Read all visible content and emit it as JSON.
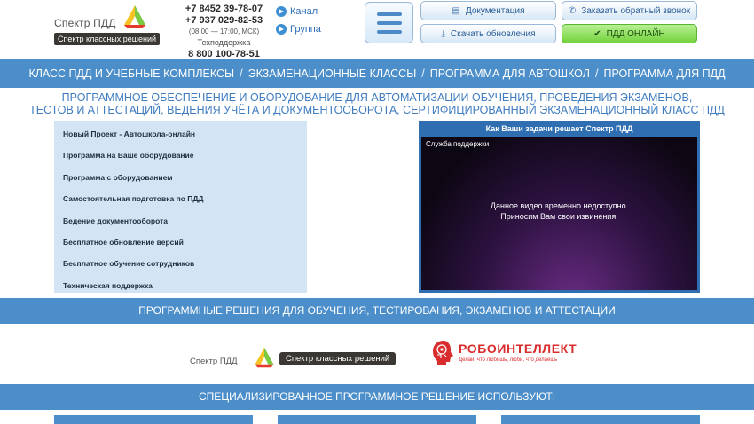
{
  "logo": {
    "name": "Спектр ПДД",
    "tagline": "Спектр классных решений",
    "colors": {
      "green": "#7ac943",
      "yellow": "#f5c324",
      "red": "#e63a2e"
    }
  },
  "contacts": {
    "phone1": "+7 8452 39-78-07",
    "phone2": "+7 937 029-82-53",
    "hours": "(08:00 — 17:00, МСК)",
    "support_label": "Техподдержка",
    "support_phone": "8 800 100-78-51"
  },
  "social": {
    "channel": "Канал",
    "group": "Группа"
  },
  "header_buttons": {
    "docs": "Документация",
    "call": "Заказать обратный звонок",
    "updates": "Скачать обновления",
    "online": "ПДД ОНЛАЙН"
  },
  "nav": {
    "items": [
      "КЛАСС ПДД И УЧЕБНЫЕ КОМПЛЕКСЫ",
      "ЭКЗАМЕНАЦИОННЫЕ КЛАССЫ",
      "ПРОГРАММА ДЛЯ АВТОШКОЛ",
      "ПРОГРАММА ДЛЯ ПДД"
    ],
    "separator": "/"
  },
  "lead": {
    "line1": "ПРОГРАММНОЕ ОБЕСПЕЧЕНИЕ И ОБОРУДОВАНИЕ ДЛЯ АВТОМАТИЗАЦИИ ОБУЧЕНИЯ, ПРОВЕДЕНИЯ ЭКЗАМЕНОВ,",
    "line2": "ТЕСТОВ И АТТЕСТАЦИЙ, ВЕДЕНИЯ УЧЁТА И ДОКУМЕНТООБОРОТА, СЕРТИФИЦИРОВАННЫЙ ЭКЗАМЕНАЦИОННЫЙ КЛАСС ПДД"
  },
  "side_menu": [
    "Новый Проект - Автошкола-онлайн",
    "Программа на Ваше оборудование",
    "Программа с оборудованием",
    "Самостоятельная подготовка по ПДД",
    "Ведение документооборота",
    "Бесплатное обновление версий",
    "Бесплатное обучение сотрудников",
    "Техническая поддержка"
  ],
  "video": {
    "title": "Как Ваши задачи решает Спектр ПДД",
    "label": "Служба поддержки",
    "message_line1": "Данное видео временно недоступно.",
    "message_line2": "Приносим Вам свои извинения."
  },
  "band1": "ПРОГРАММНЫЕ РЕШЕНИЯ ДЛЯ ОБУЧЕНИЯ, ТЕСТИРОВАНИЯ, ЭКЗАМЕНОВ И АТТЕСТАЦИИ",
  "partners": {
    "spektr_name": "Спектр ПДД",
    "spektr_tag": "Спектр классных решений",
    "robo_name": "РОБОИНТЕЛЛЕКТ",
    "robo_tag": "Делай, что любишь, люби, что делаешь"
  },
  "band2": "СПЕЦИАЛИЗИРОВАННОЕ ПРОГРАММНОЕ РЕШЕНИЕ ИСПОЛЬЗУЮТ:",
  "colors": {
    "primary_blue": "#4c8ec9",
    "lead_blue": "#3f7cc0",
    "side_bg": "#d3e4f4",
    "online_green": "#74d33d",
    "robo_red": "#d92c2c"
  }
}
